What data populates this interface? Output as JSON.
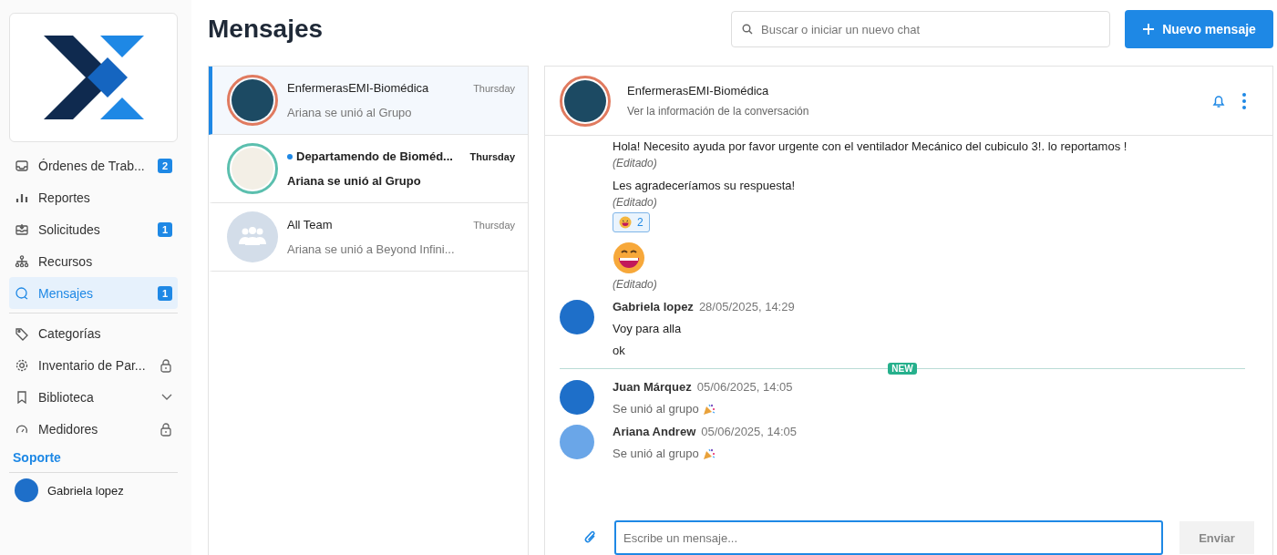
{
  "sidebar": {
    "items": [
      {
        "label": "Órdenes de Trab...",
        "badge": "2",
        "kind": "link",
        "selected": false
      },
      {
        "label": "Reportes",
        "kind": "link",
        "selected": false
      },
      {
        "label": "Solicitudes",
        "badge": "1",
        "kind": "link",
        "selected": false
      },
      {
        "label": "Recursos",
        "kind": "link",
        "selected": false
      },
      {
        "label": "Mensajes",
        "badge": "1",
        "kind": "link",
        "selected": true
      },
      {
        "label": "Categorías",
        "kind": "link",
        "selected": false
      },
      {
        "label": "Inventario de Par...",
        "kind": "locked",
        "selected": false
      },
      {
        "label": "Biblioteca",
        "kind": "group",
        "selected": false
      },
      {
        "label": "Medidores",
        "kind": "locked",
        "selected": false
      }
    ],
    "section": "Soporte",
    "user": {
      "name": "Gabriela lopez"
    }
  },
  "header": {
    "title": "Mensajes",
    "search": {
      "placeholder": "Buscar o iniciar un nuevo chat"
    },
    "new_button": "Nuevo mensaje"
  },
  "conversations": [
    {
      "name": "EnfermerasEMI-Biomédica",
      "time": "Thursday",
      "preview": "Ariana se unió al Grupo",
      "kind": "image",
      "color": "#e07a5f",
      "selected": true,
      "unread": false
    },
    {
      "name": "Departamendo de Bioméd...",
      "time": "Thursday",
      "preview": "Ariana se unió al Grupo",
      "kind": "image",
      "color": "#5bbfae",
      "selected": false,
      "unread": true
    },
    {
      "name": "All Team",
      "time": "Thursday",
      "preview": "Ariana se unió a Beyond Infini...",
      "kind": "group",
      "selected": false,
      "unread": false
    }
  ],
  "chat": {
    "name": "EnfermerasEMI-Biomédica",
    "subtitle": "Ver la información de la conversación",
    "color": "#e07a5f",
    "messages": [
      {
        "kind": "text",
        "text": "Hola! Necesito ayuda por favor urgente con el ventilador Mecánico del cubiculo 3!. lo reportamos !",
        "note": "(Editado)"
      },
      {
        "kind": "text",
        "text": "Les agradeceríamos su respuesta!",
        "note": "(Editado)",
        "reaction": "2"
      },
      {
        "kind": "emoji",
        "note": "(Editado)"
      },
      {
        "kind": "author",
        "author": "Gabriela lopez",
        "time": "28/05/2025, 14:29",
        "lines": [
          "Voy para alla",
          "ok"
        ],
        "system": false
      },
      {
        "kind": "divider",
        "label": "NEW"
      },
      {
        "kind": "author",
        "author": "Juan Márquez",
        "time": "05/06/2025, 14:05",
        "lines": [
          "Se unió al grupo"
        ],
        "system": true
      },
      {
        "kind": "author",
        "author": "Ariana Andrew",
        "time": "05/06/2025, 14:05",
        "lines": [
          "Se unió al grupo"
        ],
        "system": true
      }
    ],
    "composer": {
      "placeholder": "Escribe un mensaje...",
      "send": "Enviar",
      "send_disabled": true
    }
  }
}
